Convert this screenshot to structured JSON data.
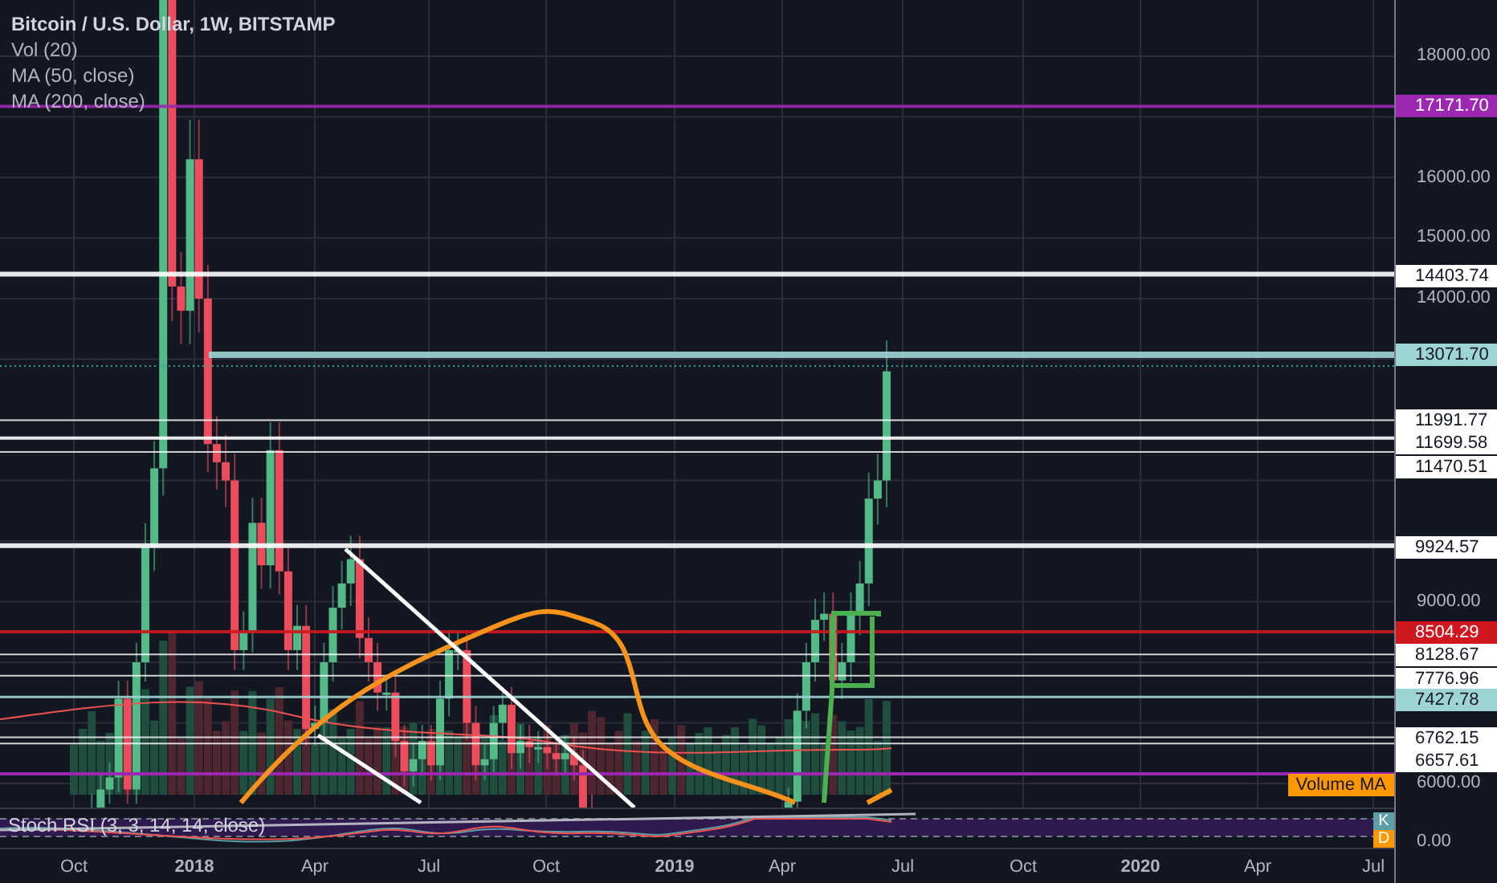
{
  "legend": [
    {
      "text": "Bitcoin / U.S. Dollar, 1W, BITSTAMP",
      "kind": "title"
    },
    {
      "text": "Vol (20)",
      "kind": "study"
    },
    {
      "text": "MA (50, close)",
      "kind": "study"
    },
    {
      "text": "MA (200, close)",
      "kind": "study"
    }
  ],
  "price_axis": {
    "ticks": [
      "18000.00",
      "16000.00",
      "15000.00",
      "14000.00",
      "9000.00",
      "6000.00"
    ]
  },
  "price_lines": [
    {
      "label": "17171.70",
      "color": "#9c27b0"
    },
    {
      "label": "14403.74",
      "color": "#ffffff"
    },
    {
      "label": "13071.70",
      "color": "#9fd4d4"
    },
    {
      "label": "11991.77",
      "color": "#ffffff"
    },
    {
      "label": "11699.58",
      "color": "#ffffff"
    },
    {
      "label": "11470.51",
      "color": "#ffffff"
    },
    {
      "label": "9924.57",
      "color": "#ffffff"
    },
    {
      "label": "8504.29",
      "color": "#d0161e"
    },
    {
      "label": "8128.67",
      "color": "#ffffff"
    },
    {
      "label": "7776.96",
      "color": "#ffffff"
    },
    {
      "label": "7427.78",
      "color": "#9fd4d4"
    },
    {
      "label": "6762.15",
      "color": "#ffffff"
    },
    {
      "label": "6657.61",
      "color": "#ffffff"
    }
  ],
  "volume_ma_tag": {
    "label": "Volume MA",
    "color": "#ff9800"
  },
  "stoch": {
    "title": "Stoch RSI (3, 3, 14, 14, close)",
    "tick": "0.00",
    "tags": [
      {
        "label": "K",
        "color": "#5b9ea6"
      },
      {
        "label": "D",
        "color": "#ff9800"
      }
    ]
  },
  "time_axis": [
    {
      "label": "Oct",
      "major": false
    },
    {
      "label": "2018",
      "major": true
    },
    {
      "label": "Apr",
      "major": false
    },
    {
      "label": "Jul",
      "major": false
    },
    {
      "label": "Oct",
      "major": false
    },
    {
      "label": "2019",
      "major": true
    },
    {
      "label": "Apr",
      "major": false
    },
    {
      "label": "Jul",
      "major": false
    },
    {
      "label": "Oct",
      "major": false
    },
    {
      "label": "2020",
      "major": true
    },
    {
      "label": "Apr",
      "major": false
    },
    {
      "label": "Jul",
      "major": false
    }
  ]
}
